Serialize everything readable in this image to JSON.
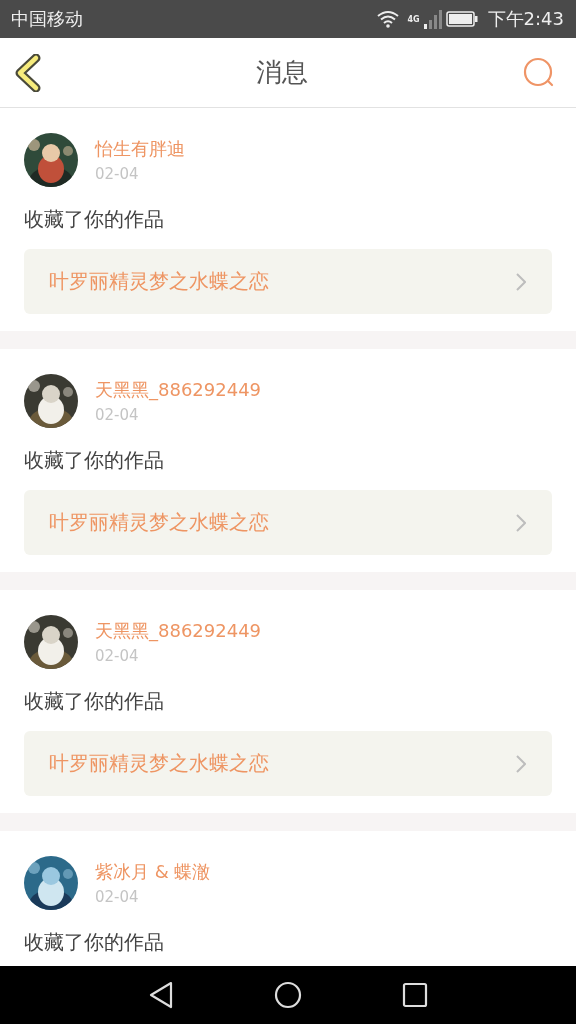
{
  "status_bar": {
    "carrier": "中国移动",
    "network": "4G",
    "time": "下午2:43"
  },
  "header": {
    "title": "消息"
  },
  "messages": [
    {
      "user": "怡生有胖迪",
      "date": "02-04",
      "action": "收藏了你的作品",
      "work": "叶罗丽精灵梦之水蝶之恋"
    },
    {
      "user": "天黑黑_886292449",
      "date": "02-04",
      "action": "收藏了你的作品",
      "work": "叶罗丽精灵梦之水蝶之恋"
    },
    {
      "user": "天黑黑_886292449",
      "date": "02-04",
      "action": "收藏了你的作品",
      "work": "叶罗丽精灵梦之水蝶之恋"
    },
    {
      "user": "紫冰月 & 蝶澈",
      "date": "02-04",
      "action": "收藏了你的作品"
    }
  ]
}
